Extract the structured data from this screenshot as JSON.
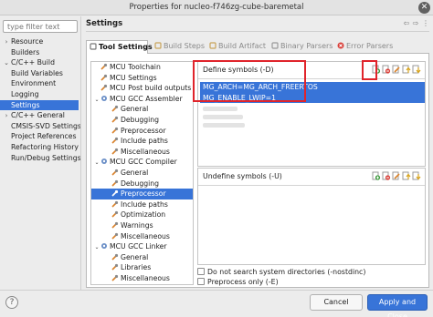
{
  "window": {
    "title": "Properties for nucleo-f746zg-cube-baremetal",
    "close_glyph": "✕"
  },
  "filter": {
    "placeholder": "type filter text"
  },
  "nav": {
    "items": [
      {
        "label": "Resource",
        "arrow": "›",
        "indent": 0
      },
      {
        "label": "Builders",
        "arrow": "",
        "indent": 0
      },
      {
        "label": "C/C++ Build",
        "arrow": "⌄",
        "indent": 0
      },
      {
        "label": "Build Variables",
        "arrow": "",
        "indent": 1
      },
      {
        "label": "Environment",
        "arrow": "",
        "indent": 1
      },
      {
        "label": "Logging",
        "arrow": "",
        "indent": 1
      },
      {
        "label": "Settings",
        "arrow": "",
        "indent": 1,
        "selected": true
      },
      {
        "label": "C/C++ General",
        "arrow": "›",
        "indent": 0
      },
      {
        "label": "CMSIS-SVD Settings",
        "arrow": "",
        "indent": 0
      },
      {
        "label": "Project References",
        "arrow": "",
        "indent": 0
      },
      {
        "label": "Refactoring History",
        "arrow": "",
        "indent": 0
      },
      {
        "label": "Run/Debug Settings",
        "arrow": "",
        "indent": 0
      }
    ]
  },
  "page": {
    "heading": "Settings",
    "back_glyph": "⇦",
    "forward_glyph": "⇨",
    "menu_glyph": "⋮"
  },
  "tabs": [
    {
      "label": "Tool Settings",
      "active": true,
      "icon": "tool-settings-icon"
    },
    {
      "label": "Build Steps",
      "active": false,
      "icon": "build-steps-icon"
    },
    {
      "label": "Build Artifact",
      "active": false,
      "icon": "build-artifact-icon"
    },
    {
      "label": "Binary Parsers",
      "active": false,
      "icon": "binary-parsers-icon"
    },
    {
      "label": "Error Parsers",
      "active": false,
      "icon": "error-parsers-icon"
    }
  ],
  "tree": [
    {
      "label": "MCU Toolchain",
      "level": 0,
      "exp": "",
      "icon": "tool"
    },
    {
      "label": "MCU Settings",
      "level": 0,
      "exp": "",
      "icon": "tool"
    },
    {
      "label": "MCU Post build outputs",
      "level": 0,
      "exp": "",
      "icon": "tool"
    },
    {
      "label": "MCU GCC Assembler",
      "level": 0,
      "exp": "⌄",
      "icon": "gear"
    },
    {
      "label": "General",
      "level": 1,
      "exp": "",
      "icon": "tool"
    },
    {
      "label": "Debugging",
      "level": 1,
      "exp": "",
      "icon": "tool"
    },
    {
      "label": "Preprocessor",
      "level": 1,
      "exp": "",
      "icon": "tool"
    },
    {
      "label": "Include paths",
      "level": 1,
      "exp": "",
      "icon": "tool"
    },
    {
      "label": "Miscellaneous",
      "level": 1,
      "exp": "",
      "icon": "tool"
    },
    {
      "label": "MCU GCC Compiler",
      "level": 0,
      "exp": "⌄",
      "icon": "gear"
    },
    {
      "label": "General",
      "level": 1,
      "exp": "",
      "icon": "tool"
    },
    {
      "label": "Debugging",
      "level": 1,
      "exp": "",
      "icon": "tool"
    },
    {
      "label": "Preprocessor",
      "level": 1,
      "exp": "",
      "icon": "tool",
      "selected": true
    },
    {
      "label": "Include paths",
      "level": 1,
      "exp": "",
      "icon": "tool"
    },
    {
      "label": "Optimization",
      "level": 1,
      "exp": "",
      "icon": "tool"
    },
    {
      "label": "Warnings",
      "level": 1,
      "exp": "",
      "icon": "tool"
    },
    {
      "label": "Miscellaneous",
      "level": 1,
      "exp": "",
      "icon": "tool"
    },
    {
      "label": "MCU GCC Linker",
      "level": 0,
      "exp": "⌄",
      "icon": "gear"
    },
    {
      "label": "General",
      "level": 1,
      "exp": "",
      "icon": "tool"
    },
    {
      "label": "Libraries",
      "level": 1,
      "exp": "",
      "icon": "tool"
    },
    {
      "label": "Miscellaneous",
      "level": 1,
      "exp": "",
      "icon": "tool"
    }
  ],
  "define": {
    "title": "Define symbols (-D)",
    "symbols": [
      "MG_ARCH=MG_ARCH_FREERTOS",
      "MG_ENABLE_LWIP=1"
    ],
    "toolbar_icons": [
      "add-icon",
      "delete-icon",
      "edit-icon",
      "move-up-icon",
      "move-down-icon"
    ]
  },
  "undefine": {
    "title": "Undefine symbols (-U)",
    "toolbar_icons": [
      "add-icon",
      "delete-icon",
      "edit-icon",
      "move-up-icon",
      "move-down-icon"
    ]
  },
  "options": {
    "nostdinc": {
      "label": "Do not search system directories (-nostdinc)",
      "checked": false
    },
    "preprocess_only": {
      "label": "Preprocess only (-E)",
      "checked": false
    }
  },
  "buttons": {
    "help": "?",
    "cancel": "Cancel",
    "apply_close": "Apply and Close"
  },
  "colors": {
    "selection": "#3874d8",
    "highlight": "#e0242b",
    "add_green": "#3b9a3b",
    "delete_red": "#d9403a",
    "tool_orange": "#d9822b"
  }
}
